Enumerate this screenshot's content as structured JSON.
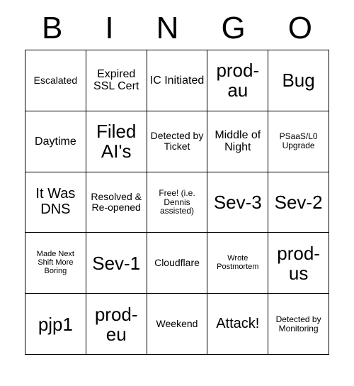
{
  "header": [
    "B",
    "I",
    "N",
    "G",
    "O"
  ],
  "cells": [
    [
      "Escalated",
      "Expired SSL Cert",
      "IC Initiated",
      "prod-au",
      "Bug"
    ],
    [
      "Daytime",
      "Filed AI's",
      "Detected by Ticket",
      "Middle of Night",
      "PSaaS/L0 Upgrade"
    ],
    [
      "It Was DNS",
      "Resolved & Re-opened",
      "Free! (i.e. Dennis assisted)",
      "Sev-3",
      "Sev-2"
    ],
    [
      "Made Next Shift More Boring",
      "Sev-1",
      "Cloudflare",
      "Wrote Postmortem",
      "prod-us"
    ],
    [
      "pjp1",
      "prod-eu",
      "Weekend",
      "Attack!",
      "Detected by Monitoring"
    ]
  ]
}
